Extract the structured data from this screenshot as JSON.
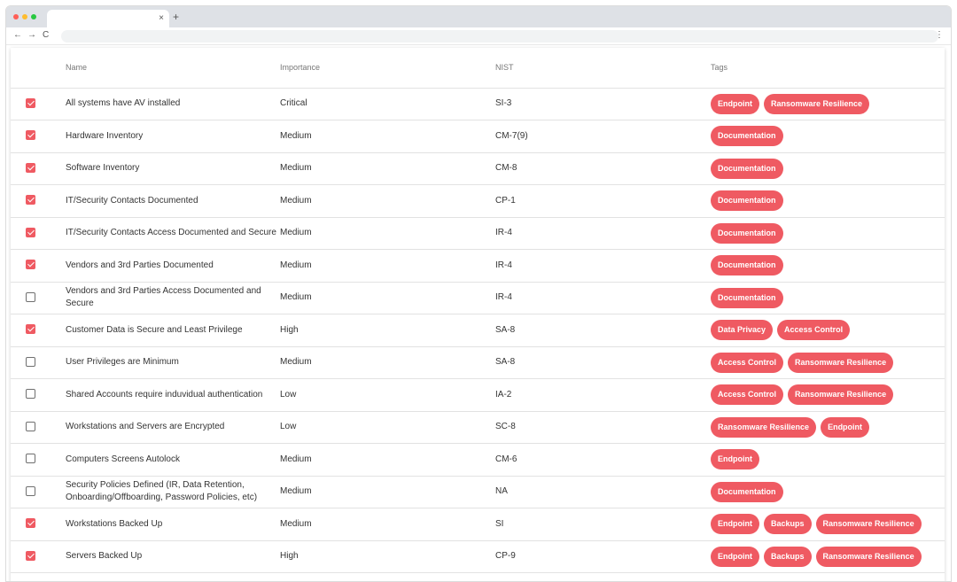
{
  "browser": {
    "tab_close": "×",
    "new_tab": "+",
    "back": "←",
    "forward": "→",
    "reload": "C",
    "menu": "⋮",
    "dot_colors": [
      "#ff5f57",
      "#febc2e",
      "#28c840"
    ]
  },
  "table": {
    "headers": {
      "name": "Name",
      "importance": "Importance",
      "nist": "NIST",
      "tags": "Tags"
    },
    "accent_color": "#ef5a62",
    "rows": [
      {
        "checked": true,
        "name": "All systems have AV installed",
        "importance": "Critical",
        "nist": "SI-3",
        "tags": [
          "Endpoint",
          "Ransomware Resilience"
        ]
      },
      {
        "checked": true,
        "name": "Hardware Inventory",
        "importance": "Medium",
        "nist": "CM-7(9)",
        "tags": [
          "Documentation"
        ]
      },
      {
        "checked": true,
        "name": "Software Inventory",
        "importance": "Medium",
        "nist": "CM-8",
        "tags": [
          "Documentation"
        ]
      },
      {
        "checked": true,
        "name": "IT/Security Contacts Documented",
        "importance": "Medium",
        "nist": "CP-1",
        "tags": [
          "Documentation"
        ]
      },
      {
        "checked": true,
        "name": "IT/Security Contacts Access Documented and Secure",
        "importance": "Medium",
        "nist": "IR-4",
        "tags": [
          "Documentation"
        ]
      },
      {
        "checked": true,
        "name": "Vendors and 3rd Parties Documented",
        "importance": "Medium",
        "nist": "IR-4",
        "tags": [
          "Documentation"
        ]
      },
      {
        "checked": false,
        "name": "Vendors and 3rd Parties Access Documented and Secure",
        "importance": "Medium",
        "nist": "IR-4",
        "tags": [
          "Documentation"
        ]
      },
      {
        "checked": true,
        "name": "Customer Data is Secure and Least Privilege",
        "importance": "High",
        "nist": "SA-8",
        "tags": [
          "Data Privacy",
          "Access Control"
        ]
      },
      {
        "checked": false,
        "name": "User Privileges are Minimum",
        "importance": "Medium",
        "nist": "SA-8",
        "tags": [
          "Access Control",
          "Ransomware Resilience"
        ]
      },
      {
        "checked": false,
        "name": "Shared Accounts require induvidual authentication",
        "importance": "Low",
        "nist": "IA-2",
        "tags": [
          "Access Control",
          "Ransomware Resilience"
        ]
      },
      {
        "checked": false,
        "name": "Workstations and Servers are Encrypted",
        "importance": "Low",
        "nist": "SC-8",
        "tags": [
          "Ransomware Resilience",
          "Endpoint"
        ]
      },
      {
        "checked": false,
        "name": "Computers Screens Autolock",
        "importance": "Medium",
        "nist": "CM-6",
        "tags": [
          "Endpoint"
        ]
      },
      {
        "checked": false,
        "name": "Security Policies Defined (IR, Data Retention, Onboarding/Offboarding, Password Policies, etc)",
        "importance": "Medium",
        "nist": "NA",
        "tags": [
          "Documentation"
        ]
      },
      {
        "checked": true,
        "name": "Workstations Backed Up",
        "importance": "Medium",
        "nist": "SI",
        "tags": [
          "Endpoint",
          "Backups",
          "Ransomware Resilience"
        ]
      },
      {
        "checked": true,
        "name": "Servers Backed Up",
        "importance": "High",
        "nist": "CP-9",
        "tags": [
          "Endpoint",
          "Backups",
          "Ransomware Resilience"
        ]
      }
    ]
  }
}
